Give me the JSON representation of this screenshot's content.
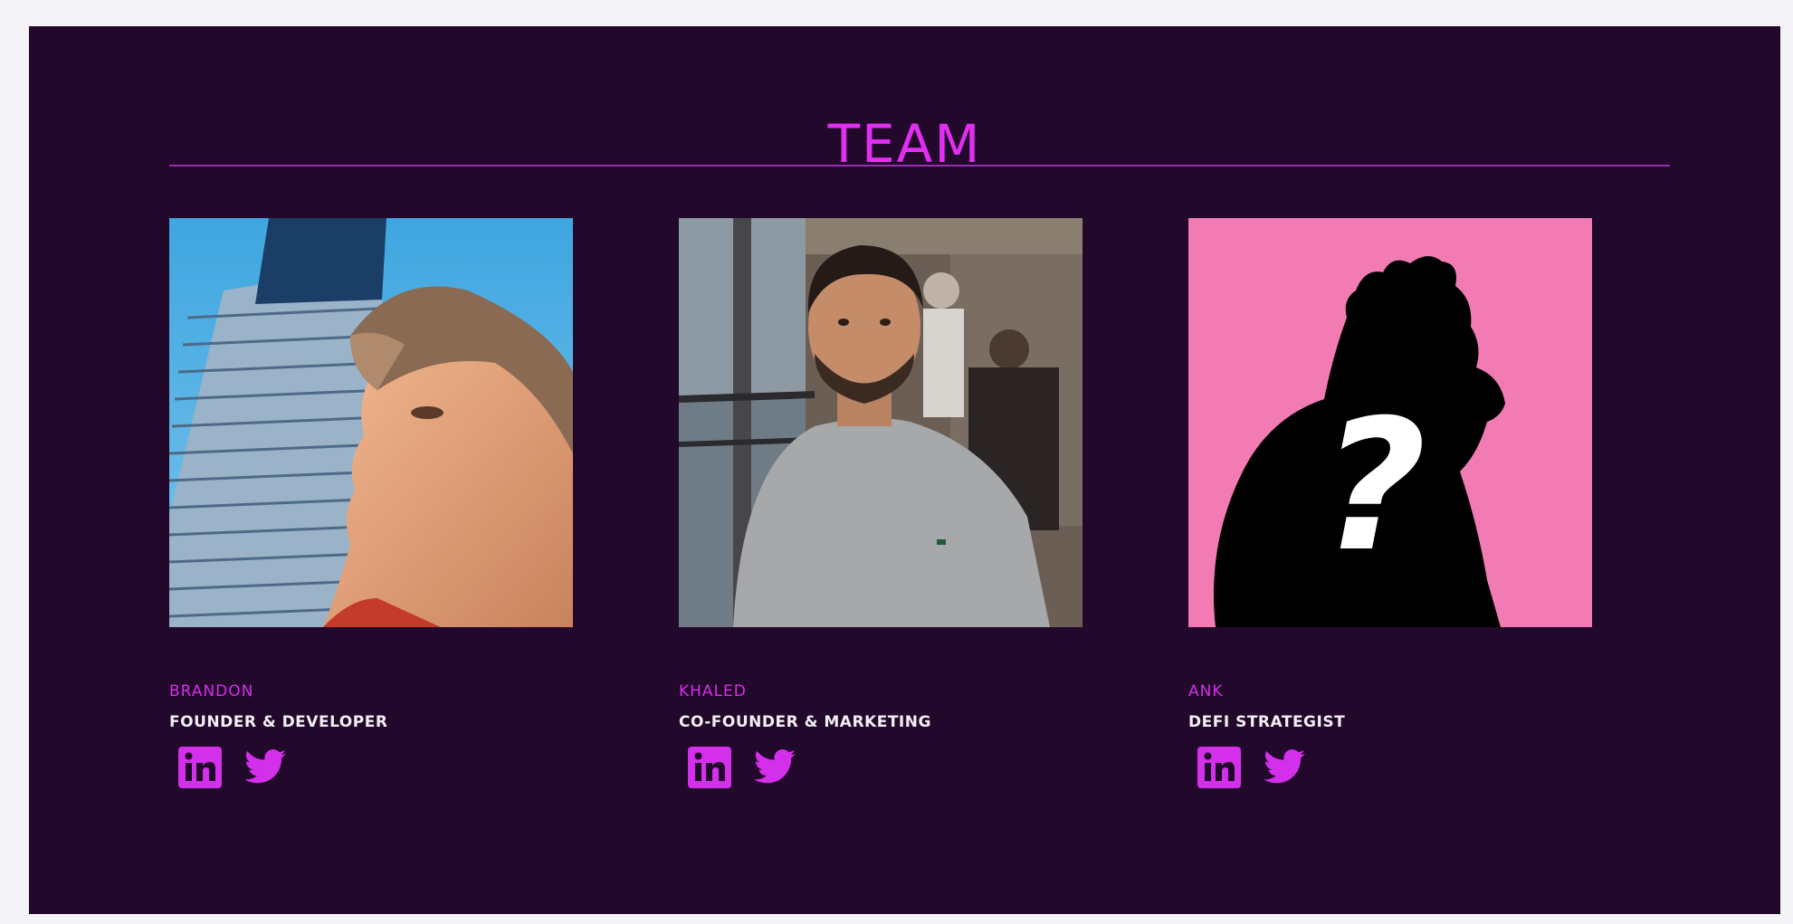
{
  "section": {
    "title": "TEAM"
  },
  "colors": {
    "background": "#22082a",
    "accent": "#e02ff0",
    "text": "#f2eef4"
  },
  "members": [
    {
      "name": "BRANDON",
      "role": "FOUNDER & DEVELOPER",
      "photo": "brandon-photo",
      "links": [
        "linkedin-icon",
        "twitter-icon"
      ]
    },
    {
      "name": "KHALED",
      "role": "CO-FOUNDER & MARKETING",
      "photo": "khaled-photo",
      "links": [
        "linkedin-icon",
        "twitter-icon"
      ]
    },
    {
      "name": "ANK",
      "role": "DEFI STRATEGIST",
      "photo": "mystery-silhouette",
      "photo_mark": "?",
      "links": [
        "linkedin-icon",
        "twitter-icon"
      ]
    }
  ]
}
